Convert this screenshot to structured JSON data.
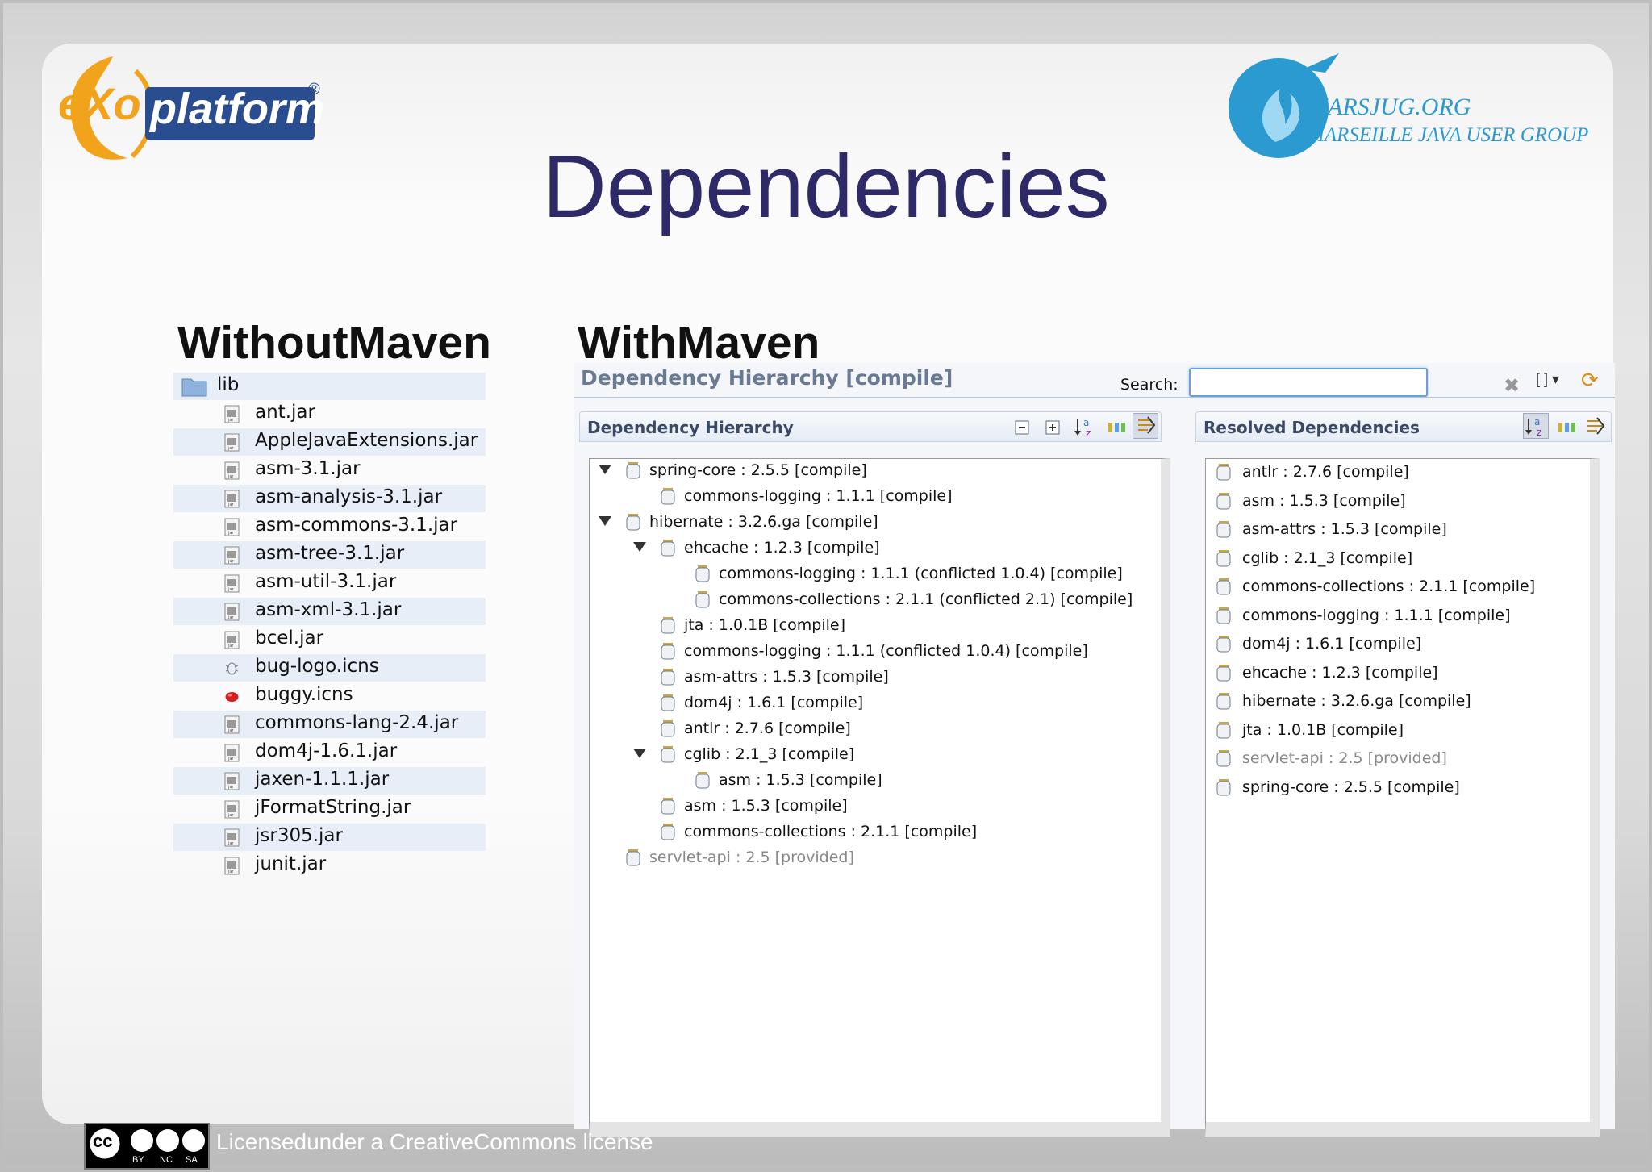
{
  "slide": {
    "title": "Dependencies",
    "exo_logo": {
      "prefix": "eXo",
      "name": "platform",
      "mark": "®"
    },
    "marsjug": {
      "name": "MARSJUG.ORG",
      "subtitle": "MARSEILLE JAVA USER GROUP"
    },
    "license_text": "Licensedunder a CreativeCommons license",
    "cc_badge": {
      "cc": "cc",
      "terms": [
        "BY",
        "NC",
        "SA"
      ]
    }
  },
  "without_maven": {
    "heading": "WithoutMaven",
    "folder": "lib",
    "files": [
      {
        "name": "ant.jar",
        "icon": "jar-icon"
      },
      {
        "name": "AppleJavaExtensions.jar",
        "icon": "jar-icon"
      },
      {
        "name": "asm-3.1.jar",
        "icon": "jar-icon"
      },
      {
        "name": "asm-analysis-3.1.jar",
        "icon": "jar-icon"
      },
      {
        "name": "asm-commons-3.1.jar",
        "icon": "jar-icon"
      },
      {
        "name": "asm-tree-3.1.jar",
        "icon": "jar-icon"
      },
      {
        "name": "asm-util-3.1.jar",
        "icon": "jar-icon"
      },
      {
        "name": "asm-xml-3.1.jar",
        "icon": "jar-icon"
      },
      {
        "name": "bcel.jar",
        "icon": "jar-icon"
      },
      {
        "name": "bug-logo.icns",
        "icon": "bug-icon"
      },
      {
        "name": "buggy.icns",
        "icon": "red-bug-icon"
      },
      {
        "name": "commons-lang-2.4.jar",
        "icon": "jar-icon"
      },
      {
        "name": "dom4j-1.6.1.jar",
        "icon": "jar-icon"
      },
      {
        "name": "jaxen-1.1.1.jar",
        "icon": "jar-icon"
      },
      {
        "name": "jFormatString.jar",
        "icon": "jar-icon"
      },
      {
        "name": "jsr305.jar",
        "icon": "jar-icon"
      },
      {
        "name": "junit.jar",
        "icon": "jar-icon"
      }
    ]
  },
  "with_maven": {
    "heading": "WithMaven",
    "editor_title": "Dependency Hierarchy [compile]",
    "search": {
      "label": "Search:",
      "value": ""
    },
    "hierarchy": {
      "header": "Dependency Hierarchy",
      "rows": [
        {
          "text": "spring-core : 2.5.5 [compile]",
          "expanded": true
        },
        {
          "text": "commons-logging : 1.1.1 [compile]"
        },
        {
          "text": "hibernate : 3.2.6.ga [compile]",
          "expanded": true
        },
        {
          "text": "ehcache : 1.2.3 [compile]",
          "expanded": true
        },
        {
          "text": "commons-logging : 1.1.1 (conflicted 1.0.4) [compile]"
        },
        {
          "text": "commons-collections : 2.1.1 (conflicted 2.1) [compile]"
        },
        {
          "text": "jta : 1.0.1B [compile]"
        },
        {
          "text": "commons-logging : 1.1.1 (conflicted 1.0.4) [compile]"
        },
        {
          "text": "asm-attrs : 1.5.3 [compile]"
        },
        {
          "text": "dom4j : 1.6.1 [compile]"
        },
        {
          "text": "antlr : 2.7.6 [compile]"
        },
        {
          "text": "cglib : 2.1_3 [compile]",
          "expanded": true
        },
        {
          "text": "asm : 1.5.3 [compile]"
        },
        {
          "text": "asm : 1.5.3 [compile]"
        },
        {
          "text": "commons-collections : 2.1.1 [compile]"
        },
        {
          "text": "servlet-api : 2.5 [provided]",
          "provided": true
        }
      ]
    },
    "resolved": {
      "header": "Resolved Dependencies",
      "rows": [
        {
          "text": "antlr : 2.7.6 [compile]"
        },
        {
          "text": "asm : 1.5.3 [compile]"
        },
        {
          "text": "asm-attrs : 1.5.3 [compile]"
        },
        {
          "text": "cglib : 2.1_3 [compile]"
        },
        {
          "text": "commons-collections : 2.1.1 [compile]"
        },
        {
          "text": "commons-logging : 1.1.1 [compile]"
        },
        {
          "text": "dom4j : 1.6.1 [compile]"
        },
        {
          "text": "ehcache : 1.2.3 [compile]"
        },
        {
          "text": "hibernate : 3.2.6.ga [compile]"
        },
        {
          "text": "jta : 1.0.1B [compile]"
        },
        {
          "text": "servlet-api : 2.5 [provided]",
          "provided": true
        },
        {
          "text": "spring-core : 2.5.5 [compile]"
        }
      ]
    },
    "toolbar_icons": [
      "collapse-all-icon",
      "expand-all-icon",
      "sort-icon",
      "show-group-id-icon",
      "filter-icon"
    ]
  },
  "colors": {
    "title": "#2e2a68",
    "panel_header": "#3a4a66",
    "selection_stripe": "#e8eef8",
    "marsjug_blue": "#2a9ad0"
  }
}
